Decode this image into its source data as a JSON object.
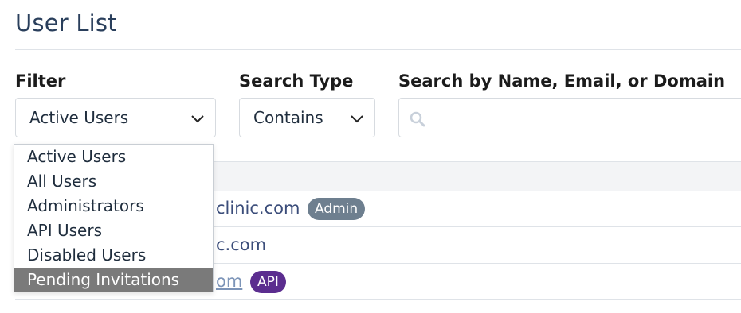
{
  "page": {
    "title": "User List"
  },
  "filters": {
    "filter_label": "Filter",
    "filter_value": "Active Users",
    "search_type_label": "Search Type",
    "search_type_value": "Contains",
    "search_label": "Search by Name, Email, or Domain",
    "search_value": "",
    "search_placeholder": ""
  },
  "dropdown": {
    "options": [
      "Active Users",
      "All Users",
      "Administrators",
      "API Users",
      "Disabled Users",
      "Pending Invitations"
    ],
    "highlighted": "Pending Invitations"
  },
  "table": {
    "rows": [
      {
        "text": "clinic.com",
        "badge": "Admin",
        "badge_color": "#6e7f8f"
      },
      {
        "text": "c.com",
        "badge": "",
        "badge_color": ""
      },
      {
        "text": "om",
        "badge": "API",
        "badge_color": "#5b2d8f"
      }
    ]
  },
  "colors": {
    "title": "#2a3f5c",
    "row_text": "#3b4d7a",
    "selected_option_bg": "#7a7a7a"
  },
  "icons": {
    "select_chevron": "chevron-down-icon",
    "search": "search-icon"
  }
}
